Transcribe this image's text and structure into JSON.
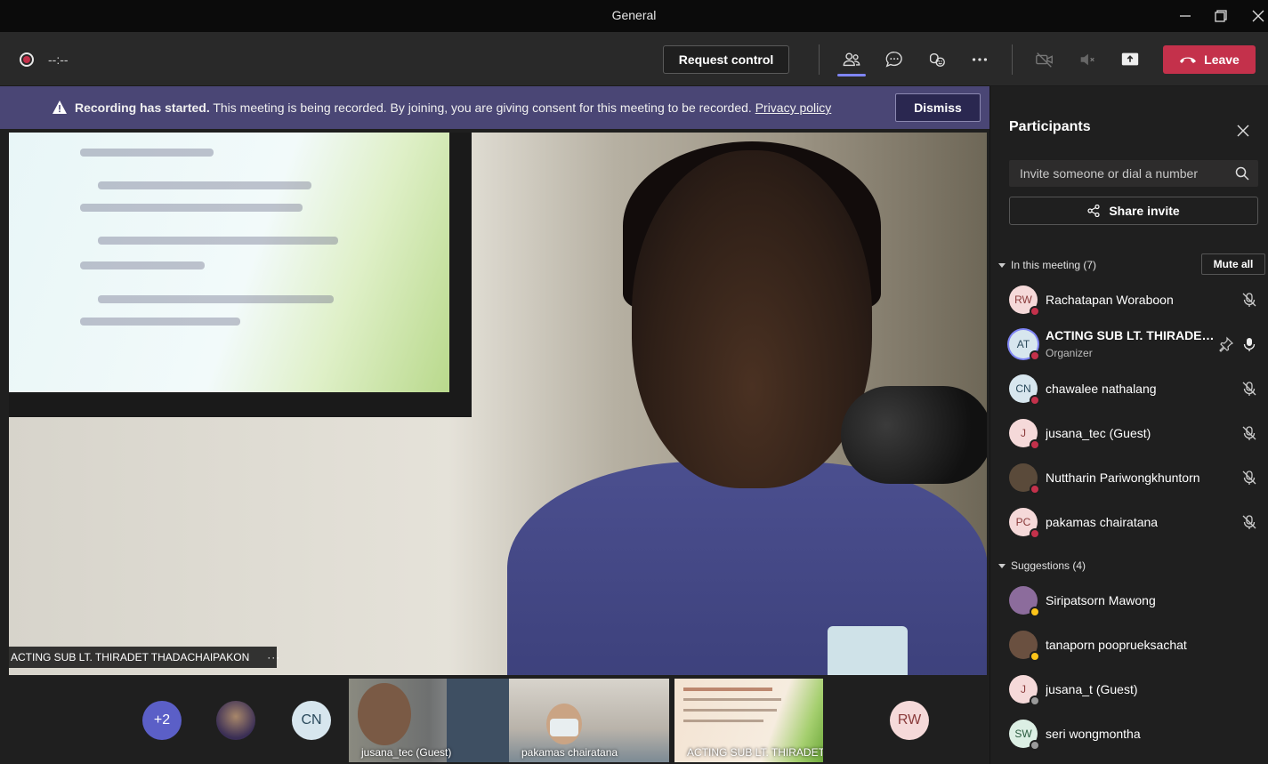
{
  "window": {
    "title": "General"
  },
  "toolbar": {
    "timer": "--:--",
    "request_control": "Request control",
    "leave": "Leave"
  },
  "banner": {
    "bold": "Recording has started.",
    "message": " This meeting is being recorded. By joining, you are giving consent for this meeting to be recorded. ",
    "link": "Privacy policy",
    "dismiss": "Dismiss"
  },
  "stage": {
    "speaker_name": "ACTING SUB LT. THIRADET THADACHAIPAKON"
  },
  "thumbnails": {
    "overflow": "+2",
    "cn": "CN",
    "rw": "RW",
    "tile1_label": "jusana_tec (Guest)",
    "tile2_label": "pakamas chairatana",
    "tile3_label": "ACTING SUB LT. THIRADET..."
  },
  "panel": {
    "title": "Participants",
    "invite_placeholder": "Invite someone or dial a number",
    "share_invite": "Share invite",
    "in_meeting_label": "In this meeting (7)",
    "mute_all": "Mute all",
    "suggestions_label": "Suggestions (4)",
    "in_meeting": [
      {
        "initials": "RW",
        "name": "Rachatapan Woraboon",
        "role": "",
        "avatar_bg": "#f5d9d9",
        "avatar_fg": "#8a3b3b",
        "status": "#c4314b"
      },
      {
        "initials": "AT",
        "name": "ACTING SUB LT. THIRADET ...",
        "role": "Organizer",
        "avatar_bg": "#d7e6ee",
        "avatar_fg": "#2b4a5c",
        "status": "#c4314b"
      },
      {
        "initials": "CN",
        "name": "chawalee nathalang",
        "role": "",
        "avatar_bg": "#d7e6ee",
        "avatar_fg": "#2b4a5c",
        "status": "#c4314b"
      },
      {
        "initials": "J",
        "name": "jusana_tec (Guest)",
        "role": "",
        "avatar_bg": "#f5d9d9",
        "avatar_fg": "#8a3b3b",
        "status": "#c4314b"
      },
      {
        "initials": "",
        "name": "Nuttharin Pariwongkhuntorn",
        "role": "",
        "avatar_bg": "#5a4a3a",
        "avatar_fg": "#fff",
        "status": "#c4314b"
      },
      {
        "initials": "PC",
        "name": "pakamas chairatana",
        "role": "",
        "avatar_bg": "#f5d9d9",
        "avatar_fg": "#8a3b3b",
        "status": "#c4314b"
      }
    ],
    "suggestions": [
      {
        "initials": "",
        "name": "Siripatsorn Mawong",
        "avatar_bg": "#8c6c9c",
        "avatar_fg": "#fff",
        "status": "#fcc419"
      },
      {
        "initials": "",
        "name": "tanaporn pooprueksachat",
        "avatar_bg": "#6a5040",
        "avatar_fg": "#fff",
        "status": "#fcc419"
      },
      {
        "initials": "J",
        "name": "jusana_t (Guest)",
        "avatar_bg": "#f5d9d9",
        "avatar_fg": "#8a3b3b",
        "status": "#9a9a9a"
      },
      {
        "initials": "SW",
        "name": "seri wongmontha",
        "avatar_bg": "#dcefe4",
        "avatar_fg": "#2b5c40",
        "status": "#9a9a9a"
      }
    ]
  }
}
